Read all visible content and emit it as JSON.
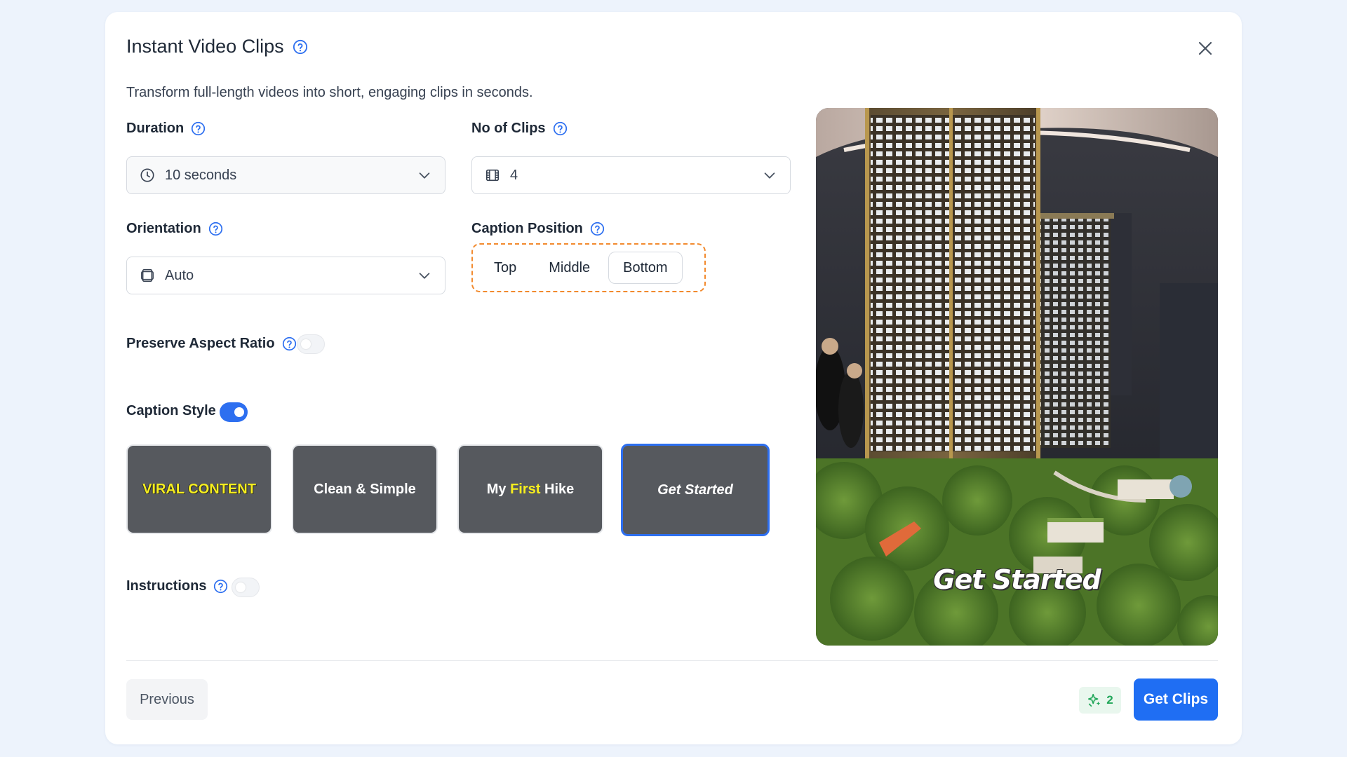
{
  "modal": {
    "title": "Instant Video Clips",
    "subtitle": "Transform full-length videos into short, engaging clips in seconds."
  },
  "duration": {
    "label": "Duration",
    "value": "10 seconds",
    "icon": "clock-icon"
  },
  "clips": {
    "label": "No of Clips",
    "value": "4",
    "icon": "film-icon"
  },
  "orientation": {
    "label": "Orientation",
    "value": "Auto",
    "icon": "orientation-icon"
  },
  "caption_position": {
    "label": "Caption Position",
    "options": [
      "Top",
      "Middle",
      "Bottom"
    ],
    "selected": "Bottom"
  },
  "preserve_aspect": {
    "label": "Preserve Aspect Ratio",
    "enabled": false
  },
  "caption_style": {
    "label": "Caption Style",
    "enabled": true,
    "styles": [
      {
        "text": "VIRAL CONTENT"
      },
      {
        "text": "Clean & Simple"
      },
      {
        "pre": "My ",
        "highlight": "First",
        "post": " Hike"
      },
      {
        "text": "Get Started"
      }
    ],
    "selected_index": 3
  },
  "instructions": {
    "label": "Instructions",
    "enabled": false
  },
  "preview": {
    "caption": "Get Started"
  },
  "footer": {
    "previous_label": "Previous",
    "credits": "2",
    "submit_label": "Get Clips"
  },
  "colors": {
    "accent": "#1f6ef3",
    "highlight_border": "#f28a2e",
    "caption_yellow": "#f6ee1e",
    "credits_green": "#22a75a"
  }
}
